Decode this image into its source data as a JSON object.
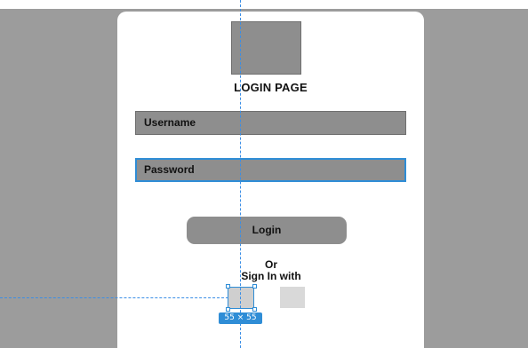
{
  "screen": {
    "title": "LOGIN PAGE",
    "username_placeholder": "Username",
    "password_placeholder": "Password",
    "login_label": "Login",
    "or_label": "Or",
    "sign_in_with_label": "Sign In with"
  },
  "selection": {
    "size_label": "55 × 55"
  },
  "colors": {
    "canvas": "#9c9c9c",
    "card": "#ffffff",
    "placeholder_fill": "#8e8e8e",
    "selection_accent": "#2f8dd6"
  }
}
